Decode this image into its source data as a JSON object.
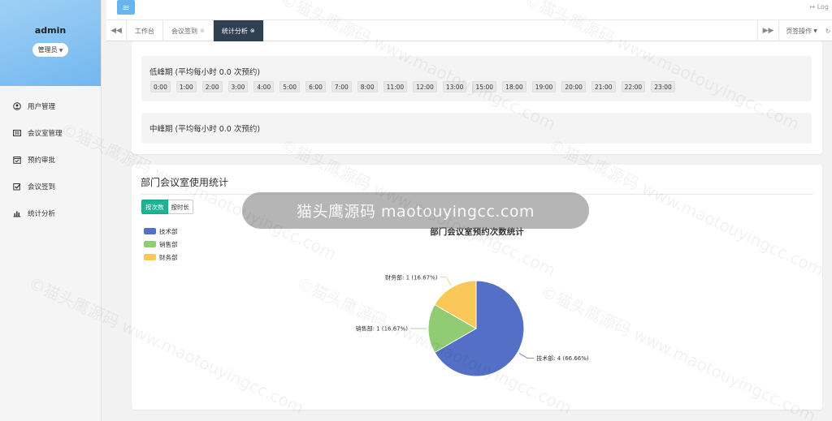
{
  "sidebar": {
    "username": "admin",
    "role": "管理员",
    "items": [
      {
        "label": "用户管理",
        "icon": "user-circle-icon"
      },
      {
        "label": "会议室管理",
        "icon": "list-alt-icon"
      },
      {
        "label": "预约审批",
        "icon": "calendar-check-icon"
      },
      {
        "label": "会议签到",
        "icon": "checkbox-icon"
      },
      {
        "label": "统计分析",
        "icon": "bar-chart-icon"
      }
    ]
  },
  "topbar": {
    "logout": "Log"
  },
  "tabs": {
    "items": [
      {
        "label": "工作台",
        "closable": false
      },
      {
        "label": "会议签到",
        "closable": true
      },
      {
        "label": "统计分析",
        "closable": true,
        "active": true
      }
    ],
    "page_ops": "页签操作"
  },
  "periods": {
    "low_title": "低峰期 (平均每小时 0.0 次预约)",
    "low_hours": [
      "0:00",
      "1:00",
      "2:00",
      "3:00",
      "4:00",
      "5:00",
      "6:00",
      "7:00",
      "8:00",
      "11:00",
      "12:00",
      "13:00",
      "15:00",
      "18:00",
      "19:00",
      "20:00",
      "21:00",
      "22:00",
      "23:00"
    ],
    "mid_title": "中峰期 (平均每小时 0.0 次预约)"
  },
  "dept": {
    "title": "部门会议室使用统计",
    "btn_count": "按次数",
    "btn_duration": "按时长"
  },
  "overlay": "猫头鹰源码 maotouyingcc.com",
  "watermark": "©猫头鹰源码 www.maotouyingcc.com",
  "chart_data": {
    "type": "pie",
    "title": "部门会议室预约次数统计",
    "legend": [
      "技术部",
      "销售部",
      "财务部"
    ],
    "legend_position": "top-left",
    "slices": [
      {
        "name": "技术部",
        "value": 4,
        "label": "技术部: 4 (66.66%)",
        "color": "#5470c6"
      },
      {
        "name": "销售部",
        "value": 1,
        "label": "销售部: 1 (16.67%)",
        "color": "#91cc75"
      },
      {
        "name": "财务部",
        "value": 1,
        "label": "财务部: 1 (16.67%)",
        "color": "#fac858"
      }
    ]
  }
}
